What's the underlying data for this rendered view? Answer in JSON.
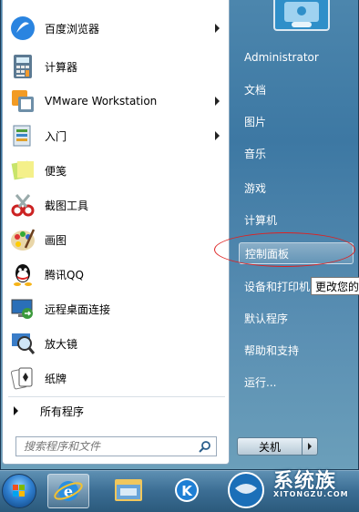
{
  "left_menu": {
    "items": [
      {
        "label": "百度浏览器",
        "icon": "baidu-browser-icon",
        "submenu": true
      },
      {
        "label": "计算器",
        "icon": "calculator-icon",
        "submenu": false
      },
      {
        "label": "VMware Workstation",
        "icon": "vmware-icon",
        "submenu": true
      },
      {
        "label": "入门",
        "icon": "getting-started-icon",
        "submenu": true
      },
      {
        "label": "便笺",
        "icon": "sticky-notes-icon",
        "submenu": false
      },
      {
        "label": "截图工具",
        "icon": "snipping-tool-icon",
        "submenu": false
      },
      {
        "label": "画图",
        "icon": "paint-icon",
        "submenu": false
      },
      {
        "label": "腾讯QQ",
        "icon": "qq-icon",
        "submenu": false
      },
      {
        "label": "远程桌面连接",
        "icon": "remote-desktop-icon",
        "submenu": false
      },
      {
        "label": "放大镜",
        "icon": "magnifier-icon",
        "submenu": false
      },
      {
        "label": "纸牌",
        "icon": "solitaire-icon",
        "submenu": false
      }
    ],
    "all_programs": "所有程序",
    "search_placeholder": "搜索程序和文件"
  },
  "right_menu": {
    "user": "Administrator",
    "items": [
      "文档",
      "图片",
      "音乐",
      "游戏",
      "计算机",
      "控制面板",
      "设备和打印机",
      "默认程序",
      "帮助和支持",
      "运行..."
    ],
    "highlighted": "控制面板",
    "shutdown": "关机"
  },
  "tooltip": "更改您的",
  "watermark": {
    "text": "系统族",
    "sub": "XITONGZU.COM"
  },
  "colors": {
    "highlight_ellipse": "#dd2222",
    "menu_bg": "#4c86ad"
  }
}
